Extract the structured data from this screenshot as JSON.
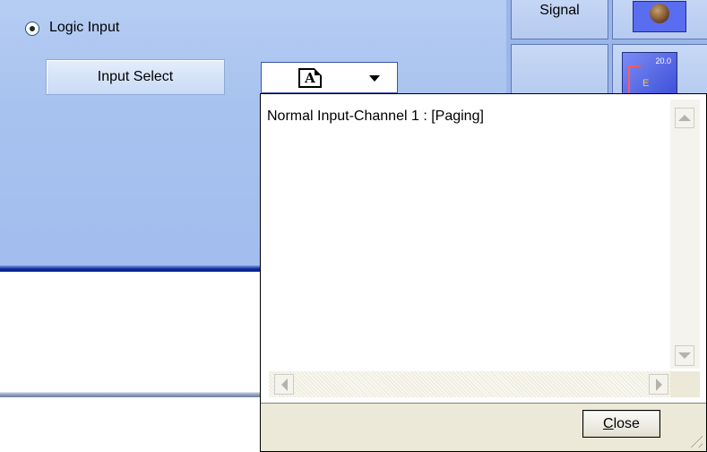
{
  "logic_input": {
    "label": "Logic Input",
    "selected": true
  },
  "input_select": {
    "button_label": "Input Select",
    "font_combo_glyph": "A"
  },
  "toolbar": {
    "signal_label": "Signal",
    "meter_value": "20.0",
    "meter_letter": "E"
  },
  "popup": {
    "items": [
      "Normal Input-Channel 1 : [Paging]"
    ],
    "close_label": "Close",
    "close_mnemonic": "C"
  },
  "colors": {
    "panel_blue": "#a8c2ef",
    "stripe_blue": "#0a2aa8",
    "window_face": "#ece9d8"
  }
}
